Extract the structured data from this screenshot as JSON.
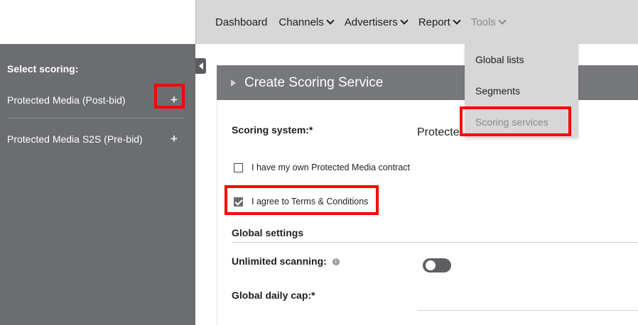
{
  "nav": {
    "items": [
      {
        "label": "Dashboard",
        "chevron": false
      },
      {
        "label": "Channels",
        "chevron": true
      },
      {
        "label": "Advertisers",
        "chevron": true
      },
      {
        "label": "Report",
        "chevron": true
      },
      {
        "label": "Tools",
        "chevron": true,
        "active": true
      }
    ]
  },
  "tools_menu": {
    "items": [
      "Global lists",
      "Segments",
      "Scoring services"
    ],
    "highlighted": "Scoring services"
  },
  "sidebar": {
    "title": "Select scoring:",
    "items": [
      {
        "label": "Protected Media (Post-bid)",
        "icon": "plus-icon",
        "highlighted": true
      },
      {
        "label": "Protected Media S2S (Pre-bid)",
        "icon": "plus-icon",
        "highlighted": false
      }
    ]
  },
  "panel": {
    "title": "Create Scoring Service",
    "scoring_system_label": "Scoring system:*",
    "scoring_system_value": "Protecte",
    "own_contract_label": "I have my own Protected Media contract",
    "own_contract_checked": false,
    "terms_label": "I agree to Terms & Conditions",
    "terms_checked": true,
    "global_settings_title": "Global settings",
    "unlimited_scanning_label": "Unlimited scanning:",
    "unlimited_scanning_on": false,
    "global_daily_cap_label": "Global daily cap:*"
  },
  "colors": {
    "highlight": "#ff0000",
    "sidebar_bg": "#6b6d70",
    "nav_bg": "#d7d7d7",
    "panel_header_bg": "#76787b"
  }
}
